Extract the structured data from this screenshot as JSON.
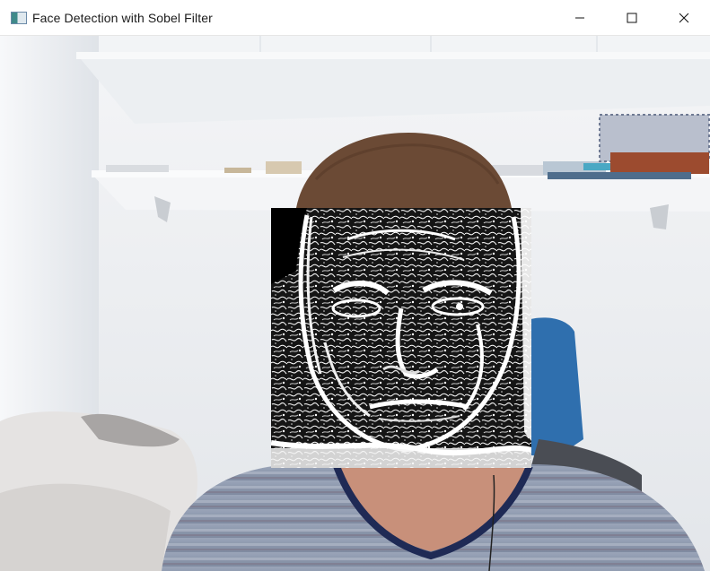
{
  "window": {
    "title": "Face Detection with Sobel Filter",
    "icon": "app-window-icon",
    "controls": {
      "minimize": "minimize-icon",
      "maximize": "maximize-icon",
      "close": "close-icon"
    }
  },
  "colors": {
    "titlebar_bg": "#ffffff",
    "title_text": "#1b1b1b",
    "wall": "#eef0f2",
    "shelf": "#f7f8f9",
    "hair": "#6b4a35",
    "skin": "#c58f78",
    "shirt": "#8f9bb0",
    "chair": "#2f6fae",
    "sobel_bg": "#111111",
    "sobel_edge": "#ffffff"
  }
}
